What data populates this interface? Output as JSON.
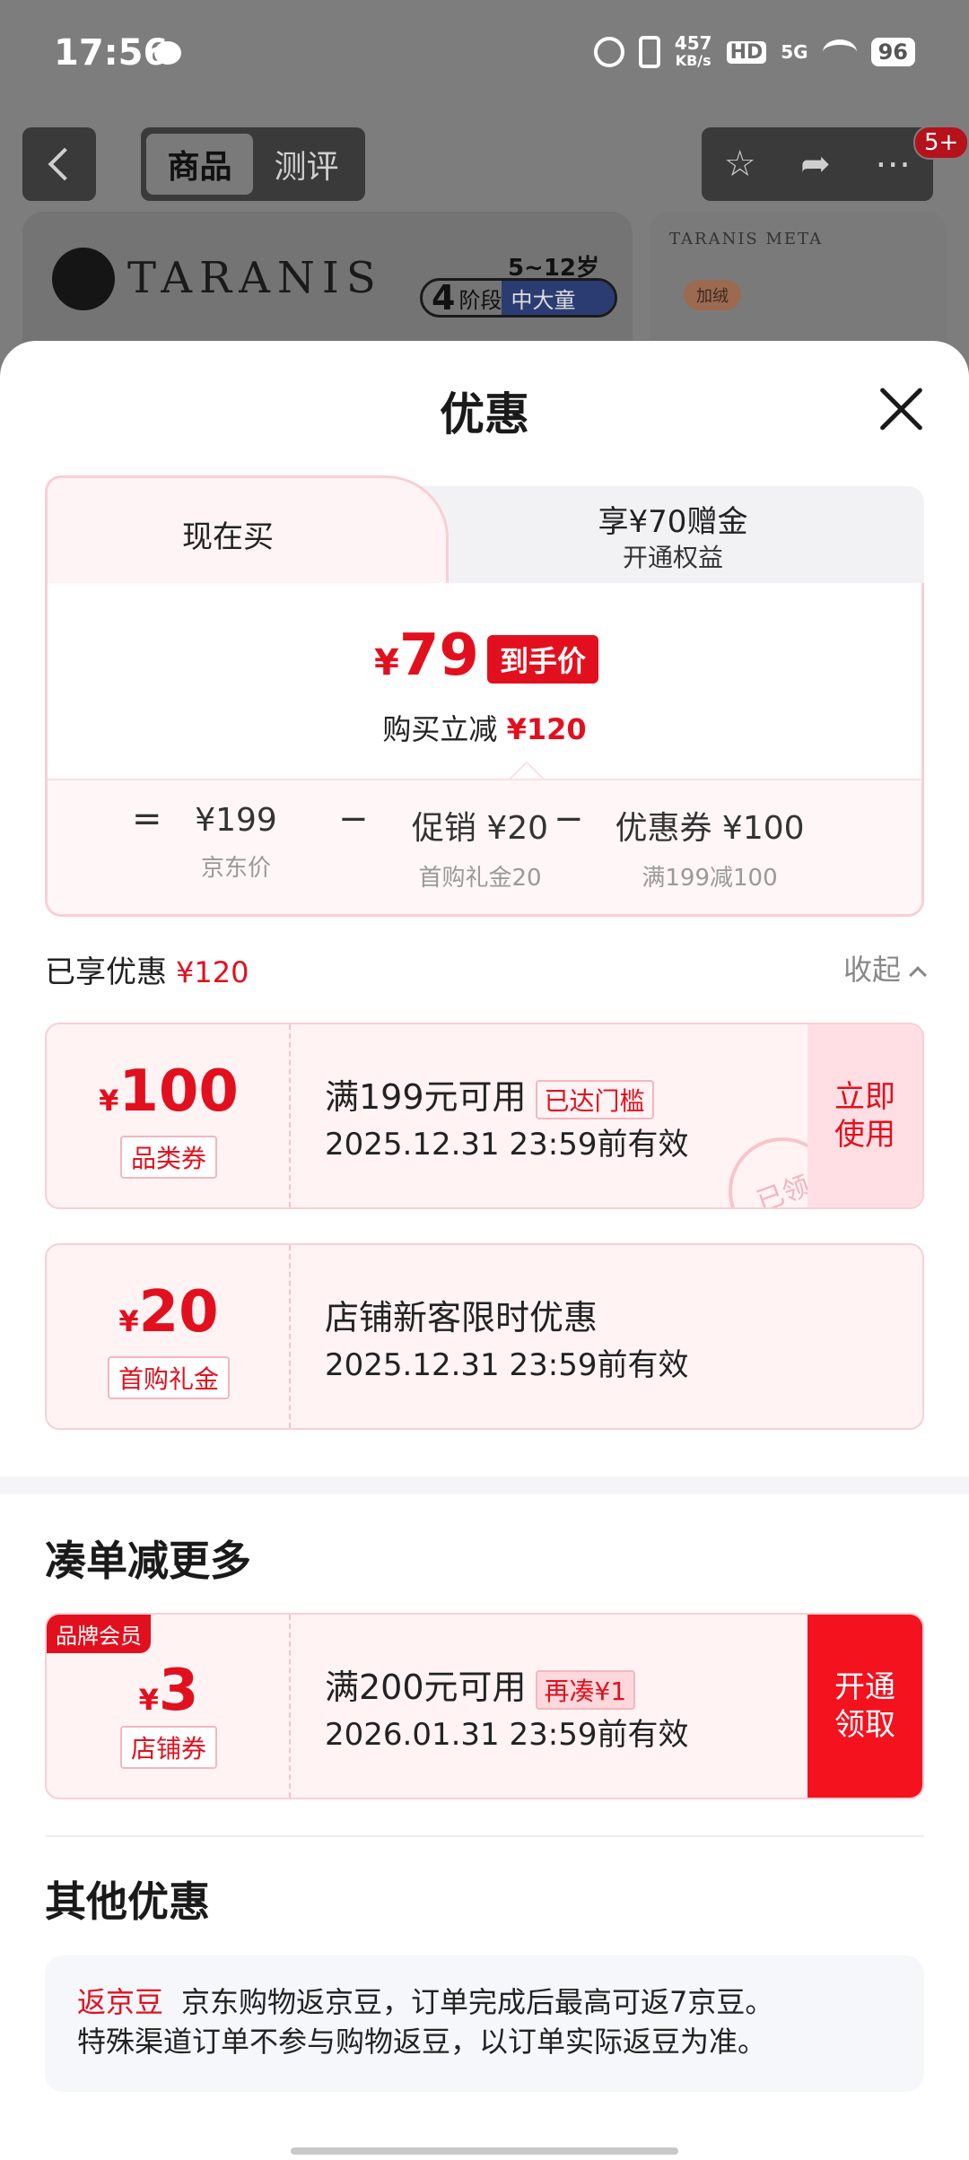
{
  "status": {
    "time": "17:56",
    "speed_value": "457",
    "speed_unit": "KB/s",
    "hd": "HD",
    "network": "5G",
    "battery": "96"
  },
  "background": {
    "tabs": [
      "商品",
      "测评"
    ],
    "badge": "5+",
    "brand": "TARANIS",
    "age_range": "5~12岁",
    "stage_num": "4",
    "stage_label": "阶段",
    "stage_group": "中大童",
    "card2_brand": "TARANIS META",
    "card2_tag": "加绒"
  },
  "sheet": {
    "title": "优惠",
    "tabs": {
      "active": "现在买",
      "inactive_line1": "享¥70赠金",
      "inactive_line2": "开通权益"
    },
    "final": {
      "currency": "¥",
      "price": "79",
      "badge": "到手价",
      "save_prefix": "购买立减",
      "save_amount": "¥120"
    },
    "breakdown": {
      "eq": "=",
      "minus": "−",
      "jd_price": "¥199",
      "jd_label": "京东价",
      "promo": "促销 ¥20",
      "promo_label": "首购礼金20",
      "coupon": "优惠券 ¥100",
      "coupon_label": "满199减100"
    },
    "enjoyed": {
      "label": "已享优惠",
      "amount": "¥120",
      "collapse": "收起"
    },
    "coupons": [
      {
        "currency": "¥",
        "amount": "100",
        "type": "品类券",
        "desc": "满199元可用",
        "tag": "已达门槛",
        "date": "2025.12.31 23:59前有效",
        "action": "立即使用",
        "stamp": "已领"
      },
      {
        "currency": "¥",
        "amount": "20",
        "type": "首购礼金",
        "desc": "店铺新客限时优惠",
        "date": "2025.12.31 23:59前有效"
      }
    ],
    "more": {
      "title": "凑单减更多",
      "coupon": {
        "member": "品牌会员",
        "currency": "¥",
        "amount": "3",
        "type": "店铺券",
        "desc": "满200元可用",
        "tag": "再凑¥1",
        "date": "2026.01.31 23:59前有效",
        "action": "开通领取"
      }
    },
    "other": {
      "title": "其他优惠",
      "label": "返京豆",
      "text1": "京东购物返京豆，订单完成后最高可返7京豆。",
      "text2": "特殊渠道订单不参与购物返豆，以订单实际返豆为准。"
    }
  }
}
